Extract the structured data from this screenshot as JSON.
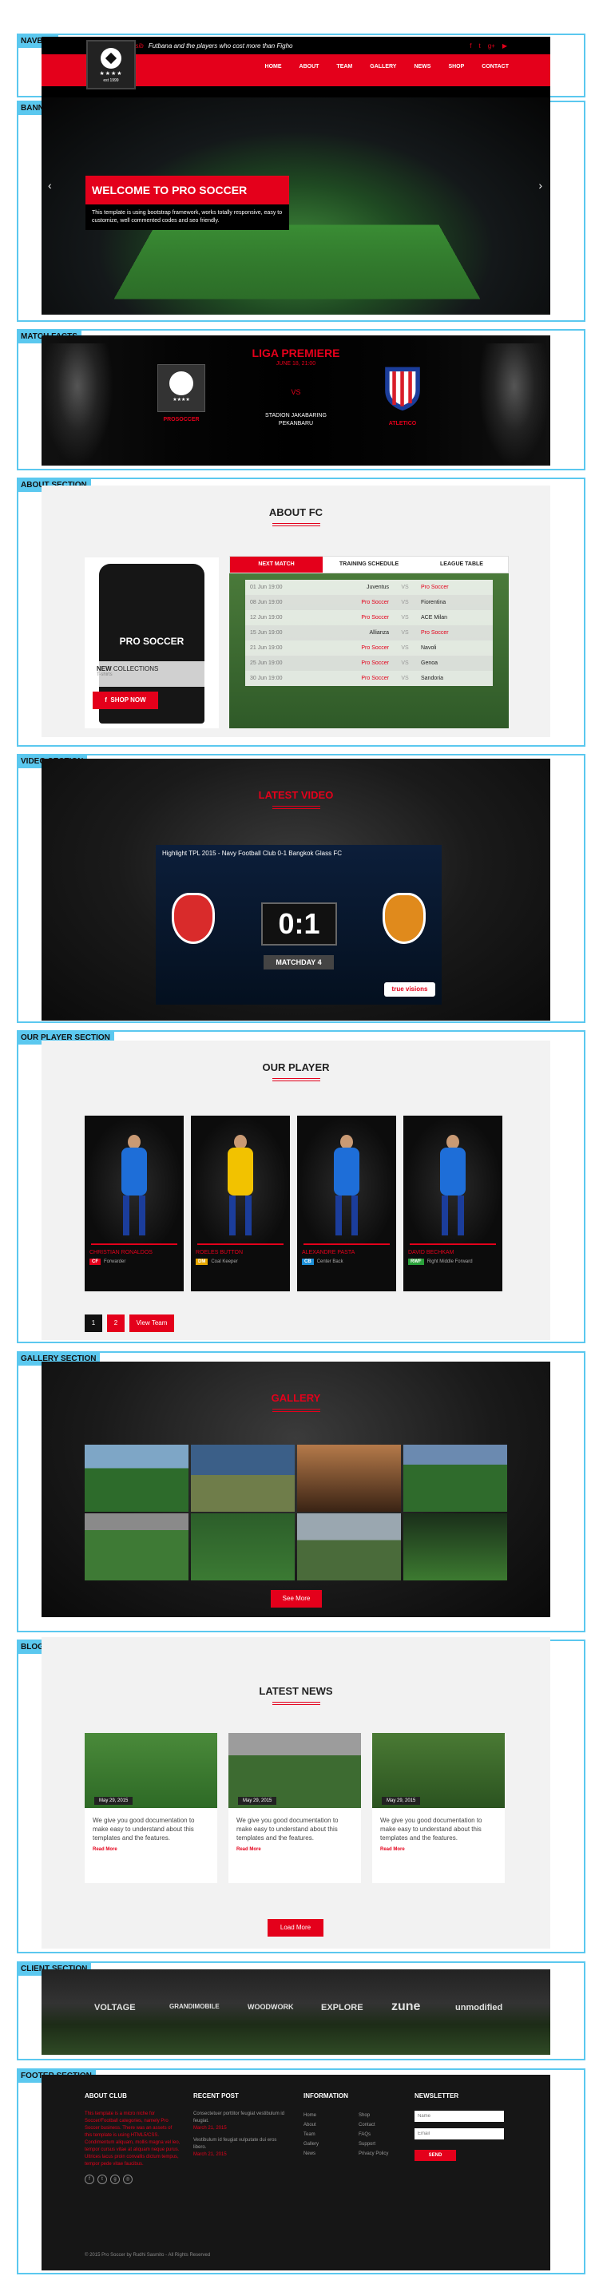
{
  "labels": {
    "navbar": "NAVBAR",
    "banner": "BANNER",
    "match": "MATCH FACTS",
    "about": "ABOUT SECTION",
    "video": "VIDEO SECTION",
    "players": "OUR PLAYER SECTION",
    "gallery": "GALLERY SECTION",
    "news": "BLOG/NEWS SECTION",
    "client": "CLIENT SECTION",
    "footer": "FOOTER SECTION"
  },
  "navbar": {
    "ticker_label": "Persib",
    "ticker_text": "Futbana and the players who cost more than Figho",
    "logo_stars": "★★★★",
    "logo_est": "est 1999",
    "social": [
      "f",
      "t",
      "g+",
      "▶"
    ],
    "menu": [
      "HOME",
      "ABOUT",
      "TEAM",
      "GALLERY",
      "NEWS",
      "SHOP",
      "CONTACT"
    ]
  },
  "banner": {
    "title": "WELCOME TO PRO SOCCER",
    "text": "This template is using bootstrap framework, works totally responsive, easy to customize, well commented codes and seo friendly.",
    "prev": "‹",
    "next": "›"
  },
  "match": {
    "league": "LIGA PREMIERE",
    "date": "JUNE 18, 21:00",
    "vs": "VS",
    "venue": [
      "STADION JAKABARING",
      "PEKANBARU"
    ],
    "home": "PROSOCCER",
    "away": "ATLETICO"
  },
  "about": {
    "title": "ABOUT FC",
    "shirt_text": "PRO SOCCER",
    "collection_title": "NEW",
    "collection_title2": "COLLECTIONS",
    "collection_sub": "T-shirts",
    "shop": "SHOP NOW",
    "tabs": [
      "NEXT MATCH",
      "TRAINING SCHEDULE",
      "LEAGUE TABLE"
    ],
    "schedule": [
      {
        "date": "01 Jun 19:00",
        "home": "Juventus",
        "vs": "VS",
        "away": "Pro Soccer"
      },
      {
        "date": "08 Jun 19:00",
        "home": "Pro Soccer",
        "vs": "VS",
        "away": "Fiorentina"
      },
      {
        "date": "12 Jun 19:00",
        "home": "Pro Soccer",
        "vs": "VS",
        "away": "ACE Milan"
      },
      {
        "date": "15 Jun 19:00",
        "home": "Allianza",
        "vs": "VS",
        "away": "Pro Soccer"
      },
      {
        "date": "21 Jun 19:00",
        "home": "Pro Soccer",
        "vs": "VS",
        "away": "Navoli"
      },
      {
        "date": "25 Jun 19:00",
        "home": "Pro Soccer",
        "vs": "VS",
        "away": "Genoa"
      },
      {
        "date": "30 Jun 19:00",
        "home": "Pro Soccer",
        "vs": "VS",
        "away": "Sandoria"
      }
    ]
  },
  "video": {
    "title": "LATEST VIDEO",
    "video_title": "Highlight TPL 2015 - Navy Football Club 0-1 Bangkok Glass FC",
    "score": "0:1",
    "matchday": "MATCHDAY 4",
    "brand": "true visions"
  },
  "players": {
    "title": "OUR PLAYER",
    "list": [
      {
        "name": "CHRISTIAN RONALDOS",
        "badge": "CF",
        "pos": "Forwarder",
        "badge_color": "#e4001b",
        "shirt": "#1e6ed8"
      },
      {
        "name": "ROELES BUTTON",
        "badge": "DM",
        "pos": "Coal Keeper",
        "badge_color": "#e8a800",
        "shirt": "#f2c200"
      },
      {
        "name": "ALEXANDRE PASTA",
        "badge": "CB",
        "pos": "Center Back",
        "badge_color": "#1e90d8",
        "shirt": "#1e6ed8"
      },
      {
        "name": "DAVID BECHKAM",
        "badge": "RWF",
        "pos": "Right Middle Forward",
        "badge_color": "#2aa13a",
        "shirt": "#1e6ed8"
      }
    ],
    "pages": [
      "1",
      "2"
    ],
    "view_team": "View Team"
  },
  "gallery": {
    "title": "GALLERY",
    "see_more": "See More"
  },
  "news": {
    "title": "LATEST NEWS",
    "posts": [
      {
        "date": "May 29, 2015",
        "text": "We give you good documentation to make easy to understand about this templates and the features.",
        "more": "Read More"
      },
      {
        "date": "May 29, 2015",
        "text": "We give you good documentation to make easy to understand about this templates and the features.",
        "more": "Read More"
      },
      {
        "date": "May 29, 2015",
        "text": "We give you good documentation to make easy to understand about this templates and the features.",
        "more": "Read More"
      }
    ],
    "load_more": "Load More"
  },
  "client": {
    "logos": [
      "VOLTAGE",
      "GRANDIMOBILE",
      "WOODWORK",
      "EXPLORE",
      "zune",
      "unmodified"
    ]
  },
  "footer": {
    "about_title": "ABOUT CLUB",
    "about_text": "This template is a micro niche for Soccer/Football categories, namely Pro Soccer business. There was an assets of this template is using HTML5/CSS. Condimentum aliquam, mollis magna vel leo, tempor cursus vitae at aliquam neque purus. Ultrices lacus proin convallis dictum tempus, tempor pede vitae faucibus.",
    "social": [
      "f",
      "t",
      "g",
      "◎"
    ],
    "recent_title": "RECENT POST",
    "recent": [
      {
        "text": "Consectetuer porttitor feugiat vestibulum id feugiat.",
        "date": "March 21, 2015"
      },
      {
        "text": "Vestibulum id feugiat vulputate dui eros libero.",
        "date": "March 21, 2015"
      }
    ],
    "info_title": "INFORMATION",
    "info_col1": [
      "Home",
      "About",
      "Team",
      "Gallery",
      "News"
    ],
    "info_col2": [
      "Shop",
      "Contact",
      "FAQs",
      "Support",
      "Privacy Policy"
    ],
    "newsletter_title": "NEWSLETTER",
    "name_placeholder": "Name",
    "email_placeholder": "Email",
    "send": "SEND",
    "copyright": "© 2015 Pro Soccer by Rudhi Sasmito - All Rights Reserved"
  }
}
